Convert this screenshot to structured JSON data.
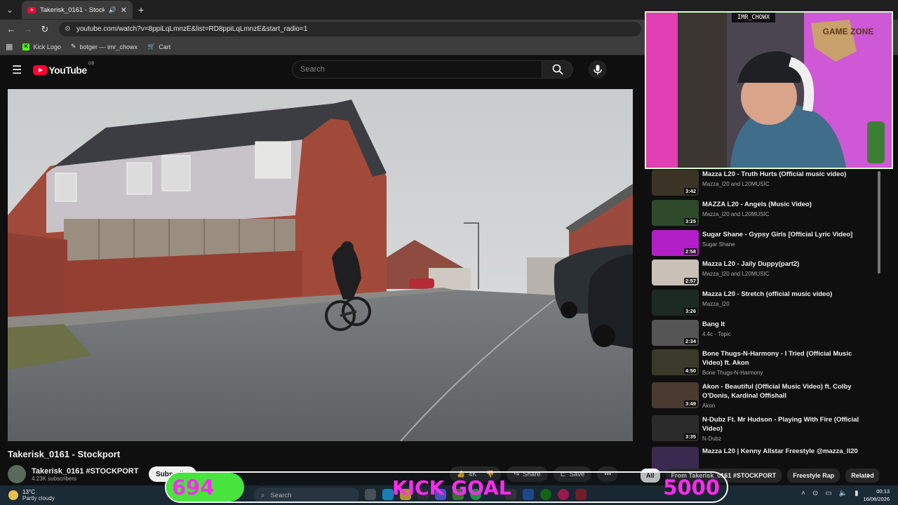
{
  "browser": {
    "tab_title": "Takerisk_0161 - Stockport",
    "url": "youtube.com/watch?v=8ppiLqLmnzE&list=RD8ppiLqLmnzE&start_radio=1",
    "bookmarks": [
      {
        "label": "Kick Logo"
      },
      {
        "label": "botger — imr_chowx"
      },
      {
        "label": "Cart"
      }
    ]
  },
  "youtube": {
    "logo_text": "YouTube",
    "region": "GB",
    "search_placeholder": "Search",
    "video_title": "Takerisk_0161 - Stockport",
    "channel_name": "Takerisk_0161 #STOCKPORT",
    "subscribers": "4.23K subscribers",
    "subscribe_label": "Subscribe",
    "like_count": "4K",
    "share_label": "Share",
    "save_label": "Save",
    "more_label": "•••"
  },
  "webcam": {
    "label": "IMR_CHOWX",
    "sign": "GAME ZONE"
  },
  "recommendations": [
    {
      "title": "Mazza L20 - Truth Hurts (Official music video)",
      "channel": "Mazza_l20 and L20MUSIC",
      "duration": "3:42",
      "color": "#3b3325"
    },
    {
      "title": "MAZZA L20 - Angels (Music Video)",
      "channel": "Mazza_l20 and L20MUSIC",
      "duration": "3:25",
      "color": "#2e4a2b"
    },
    {
      "title": "Sugar Shane - Gypsy Girls [Official Lyric Video]",
      "channel": "Sugar Shane",
      "duration": "2:58",
      "color": "#b21fc7"
    },
    {
      "title": "Mazza L20 - Jaily Duppy(part2)",
      "channel": "Mazza_l20 and L20MUSIC",
      "duration": "2:57",
      "color": "#c9c0b8"
    },
    {
      "title": "Mazza L20 - Stretch (official music video)",
      "channel": "Mazza_l20",
      "duration": "3:26",
      "color": "#1d2a24"
    },
    {
      "title": "Bang It",
      "channel": "4.4c - Topic",
      "duration": "2:34",
      "color": "#555555"
    },
    {
      "title": "Bone Thugs-N-Harmony - I Tried (Official Music Video) ft. Akon",
      "channel": "Bone Thugs-N-Harmony",
      "duration": "4:50",
      "color": "#3a3a2a"
    },
    {
      "title": "Akon - Beautiful (Official Music Video) ft. Colby O'Donis, Kardinal Offishall",
      "channel": "Akon",
      "duration": "3:49",
      "color": "#4a3a30"
    },
    {
      "title": "N-Dubz Ft. Mr Hudson - Playing With Fire (Official Video)",
      "channel": "N-Dubz",
      "duration": "3:35",
      "color": "#2b2b2b"
    },
    {
      "title": "Mazza L20 | Kenny Allstar Freestyle @mazza_ll20",
      "channel": "",
      "duration": "",
      "color": "#3a2a50"
    }
  ],
  "chips": [
    "All",
    "From Takerisk_0161 #STOCKPORT",
    "Freestyle Rap",
    "Related"
  ],
  "taskbar": {
    "temperature": "13°C",
    "weather": "Partly cloudy",
    "search_label": "Search",
    "time": "00:13",
    "date": "16/08/2026"
  },
  "goal": {
    "current": "694",
    "label": "KICK GOAL",
    "target": "5000",
    "progress": 0.139
  }
}
